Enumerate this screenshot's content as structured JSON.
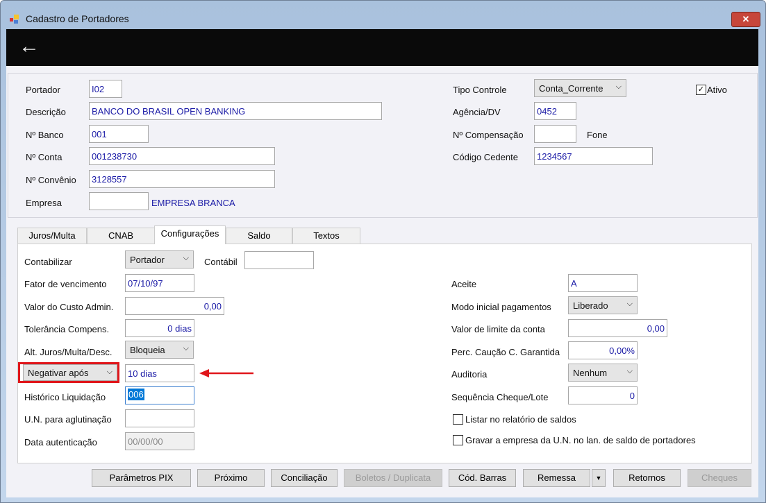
{
  "window": {
    "title": "Cadastro de Portadores",
    "close": "✕",
    "back": "←"
  },
  "header": {
    "portador_label": "Portador",
    "portador": "I02",
    "descricao_label": "Descrição",
    "descricao": "BANCO DO BRASIL OPEN BANKING",
    "banco_label": "Nº Banco",
    "banco": "001",
    "conta_label": "Nº Conta",
    "conta": "001238730",
    "convenio_label": "Nº Convênio",
    "convenio": "3128557",
    "empresa_label": "Empresa",
    "empresa": "",
    "empresa_nome": "EMPRESA BRANCA",
    "tipo_controle_label": "Tipo Controle",
    "tipo_controle": "Conta_Corrente",
    "agencia_label": "Agência/DV",
    "agencia": "0452",
    "compensacao_label": "Nº Compensação",
    "compensacao": "",
    "fone_label": "Fone",
    "cedente_label": "Código Cedente",
    "cedente": "1234567",
    "ativo_label": "Ativo",
    "ativo": true
  },
  "tabs": [
    "Juros/Multa",
    "CNAB",
    "Configurações",
    "Saldo",
    "Textos"
  ],
  "active_tab": "Configurações",
  "config": {
    "contabilizar_label": "Contabilizar",
    "contabilizar": "Portador",
    "contabil_label": "Contábil",
    "contabil": "",
    "fator_label": "Fator de vencimento",
    "fator": "07/10/97",
    "custo_label": "Valor do Custo Admin.",
    "custo": "0,00",
    "tolerancia_label": "Tolerância Compens.",
    "tolerancia": "0 dias",
    "alt_label": "Alt. Juros/Multa/Desc.",
    "alt": "Bloqueia",
    "negativar": "Negativar após",
    "negativar_value": "10 dias",
    "historico_label": "Histórico Liquidação",
    "historico": "006",
    "un_label": "U.N. para aglutinação",
    "un": "",
    "data_aut_label": "Data autenticação",
    "data_aut": "00/00/00",
    "aceite_label": "Aceite",
    "aceite": "A",
    "modo_label": "Modo inicial pagamentos",
    "modo": "Liberado",
    "limite_label": "Valor de limite da conta",
    "limite": "0,00",
    "caucao_label": "Perc. Caução C. Garantida",
    "caucao": "0,00%",
    "auditoria_label": "Auditoria",
    "auditoria": "Nenhum",
    "sequencia_label": "Sequência Cheque/Lote",
    "sequencia": "0",
    "listar_label": "Listar no relatório de saldos",
    "listar": false,
    "gravar_label": "Gravar a empresa da U.N. no lan. de saldo de portadores",
    "gravar": false
  },
  "buttons": {
    "pix": "Parâmetros PIX",
    "proximo": "Próximo",
    "conciliacao": "Conciliação",
    "boletos": "Boletos / Duplicata",
    "barras": "Cód. Barras",
    "remessa": "Remessa",
    "retornos": "Retornos",
    "cheques": "Cheques"
  },
  "colors": {
    "highlight": "#e0161b",
    "field_text": "#1a1aa6"
  }
}
